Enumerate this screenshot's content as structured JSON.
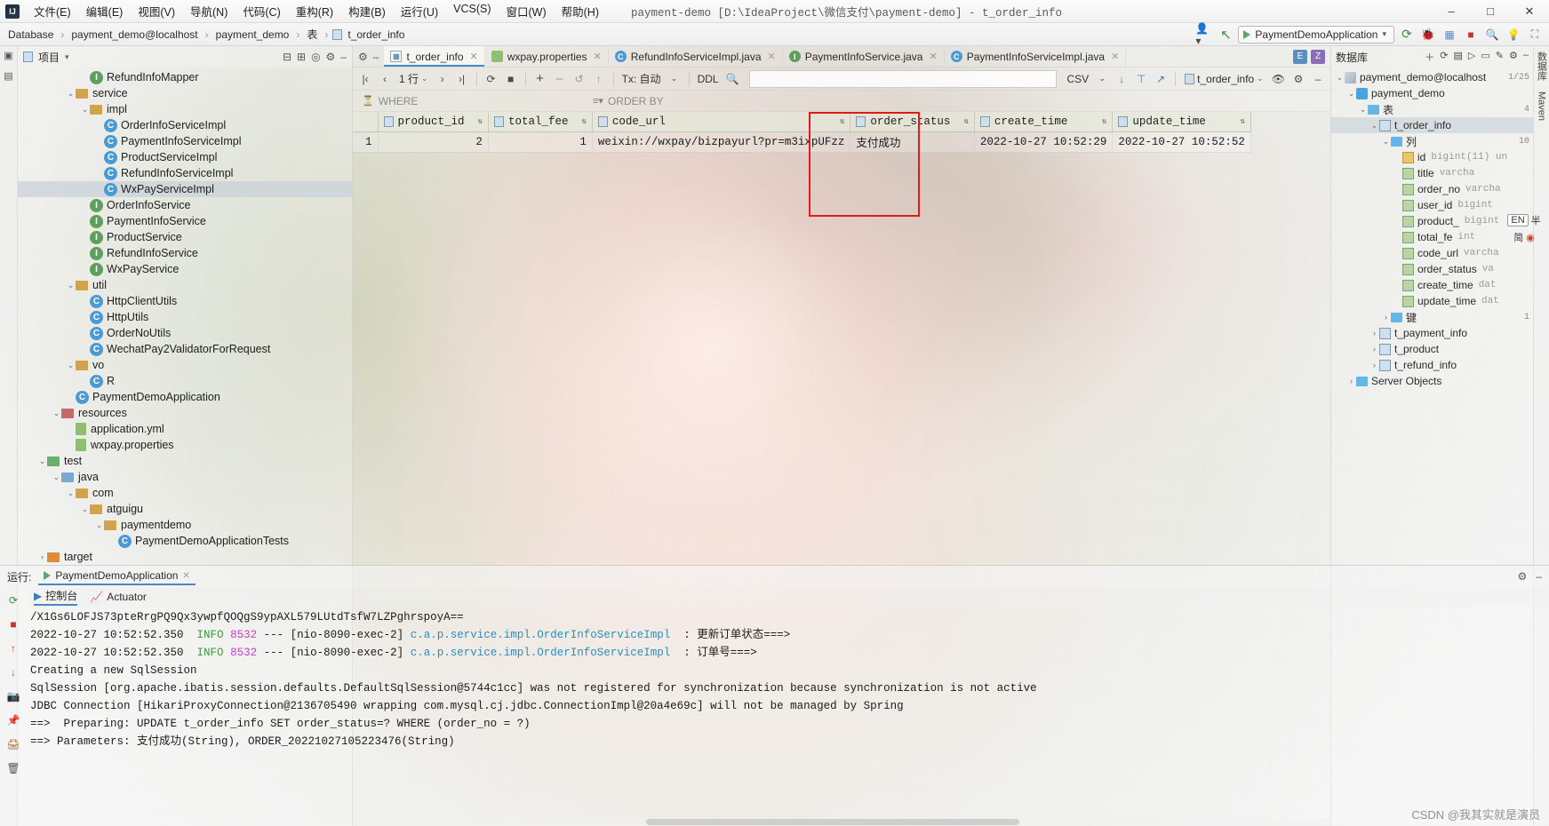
{
  "window": {
    "title": "payment-demo [D:\\IdeaProject\\微信支付\\payment-demo] - t_order_info",
    "logo": "IJ",
    "minimize": "–",
    "maximize": "□",
    "close": "✕"
  },
  "menu": [
    {
      "label": "文件(E)"
    },
    {
      "label": "编辑(E)"
    },
    {
      "label": "视图(V)"
    },
    {
      "label": "导航(N)"
    },
    {
      "label": "代码(C)"
    },
    {
      "label": "重构(R)"
    },
    {
      "label": "构建(B)"
    },
    {
      "label": "运行(U)"
    },
    {
      "label": "VCS(S)"
    },
    {
      "label": "窗口(W)"
    },
    {
      "label": "帮助(H)"
    }
  ],
  "breadcrumb": {
    "items": [
      "Database",
      "payment_demo@localhost",
      "payment_demo",
      "表",
      "t_order_info"
    ],
    "separator": "›",
    "table_icon": "table-icon"
  },
  "toolbar": {
    "run_config": "PaymentDemoApplication",
    "icons": [
      "user-icon",
      "back-arrow-icon",
      "run-icon",
      "rerun-icon",
      "debug-icon",
      "stop-icon",
      "search-icon",
      "bulb-icon",
      "scan-icon"
    ]
  },
  "left_strip": {
    "items": [
      "项目",
      "收藏"
    ]
  },
  "project_pane": {
    "title": "项目",
    "dropdown": "▾",
    "header_icons": [
      "collapse-icon",
      "expand-icon",
      "target-icon",
      "settings-icon",
      "hide-icon"
    ],
    "tree": [
      {
        "indent": 4,
        "arrow": "",
        "icon": "interface",
        "label": "RefundInfoMapper"
      },
      {
        "indent": 3,
        "arrow": "⌄",
        "icon": "folder",
        "label": "service"
      },
      {
        "indent": 4,
        "arrow": "⌄",
        "icon": "folder",
        "label": "impl"
      },
      {
        "indent": 5,
        "arrow": "",
        "icon": "class",
        "label": "OrderInfoServiceImpl"
      },
      {
        "indent": 5,
        "arrow": "",
        "icon": "class",
        "label": "PaymentInfoServiceImpl"
      },
      {
        "indent": 5,
        "arrow": "",
        "icon": "class",
        "label": "ProductServiceImpl"
      },
      {
        "indent": 5,
        "arrow": "",
        "icon": "class",
        "label": "RefundInfoServiceImpl"
      },
      {
        "indent": 5,
        "arrow": "",
        "icon": "class",
        "label": "WxPayServiceImpl",
        "selected": true
      },
      {
        "indent": 4,
        "arrow": "",
        "icon": "interface",
        "label": "OrderInfoService"
      },
      {
        "indent": 4,
        "arrow": "",
        "icon": "interface",
        "label": "PaymentInfoService"
      },
      {
        "indent": 4,
        "arrow": "",
        "icon": "interface",
        "label": "ProductService"
      },
      {
        "indent": 4,
        "arrow": "",
        "icon": "interface",
        "label": "RefundInfoService"
      },
      {
        "indent": 4,
        "arrow": "",
        "icon": "interface",
        "label": "WxPayService"
      },
      {
        "indent": 3,
        "arrow": "⌄",
        "icon": "folder",
        "label": "util"
      },
      {
        "indent": 4,
        "arrow": "",
        "icon": "class",
        "label": "HttpClientUtils"
      },
      {
        "indent": 4,
        "arrow": "",
        "icon": "class",
        "label": "HttpUtils"
      },
      {
        "indent": 4,
        "arrow": "",
        "icon": "class",
        "label": "OrderNoUtils"
      },
      {
        "indent": 4,
        "arrow": "",
        "icon": "class",
        "label": "WechatPay2ValidatorForRequest"
      },
      {
        "indent": 3,
        "arrow": "⌄",
        "icon": "folder",
        "label": "vo"
      },
      {
        "indent": 4,
        "arrow": "",
        "icon": "class",
        "label": "R"
      },
      {
        "indent": 3,
        "arrow": "",
        "icon": "class",
        "label": "PaymentDemoApplication"
      },
      {
        "indent": 2,
        "arrow": "⌄",
        "icon": "folder-res",
        "label": "resources"
      },
      {
        "indent": 3,
        "arrow": "",
        "icon": "file-yml",
        "label": "application.yml"
      },
      {
        "indent": 3,
        "arrow": "",
        "icon": "file-prop",
        "label": "wxpay.properties"
      },
      {
        "indent": 1,
        "arrow": "⌄",
        "icon": "folder-test",
        "label": "test"
      },
      {
        "indent": 2,
        "arrow": "⌄",
        "icon": "folder-src",
        "label": "java"
      },
      {
        "indent": 3,
        "arrow": "⌄",
        "icon": "folder",
        "label": "com"
      },
      {
        "indent": 4,
        "arrow": "⌄",
        "icon": "folder",
        "label": "atguigu"
      },
      {
        "indent": 5,
        "arrow": "⌄",
        "icon": "folder",
        "label": "paymentdemo"
      },
      {
        "indent": 6,
        "arrow": "",
        "icon": "class",
        "label": "PaymentDemoApplicationTests"
      },
      {
        "indent": 1,
        "arrow": "›",
        "icon": "folder-tgt",
        "label": "target"
      }
    ]
  },
  "editor": {
    "tabs": [
      {
        "label": "t_order_info",
        "icon": "table-icon",
        "active": true
      },
      {
        "label": "wxpay.properties",
        "icon": "properties-icon",
        "active": false
      },
      {
        "label": "RefundInfoServiceImpl.java",
        "icon": "class-icon",
        "active": false
      },
      {
        "label": "PaymentInfoService.java",
        "icon": "interface-icon",
        "active": false
      },
      {
        "label": "PaymentInfoServiceImpl.java",
        "icon": "class-icon",
        "active": false
      }
    ],
    "tail_chips": [
      "E",
      "Z"
    ]
  },
  "grid_toolbar": {
    "first_page": "|‹",
    "prev_page": "‹",
    "row_count": "1 行",
    "row_count_caret": "⌄",
    "next_page": "›",
    "last_page": "›|",
    "refresh": "⟳",
    "stop": "■",
    "add_row": "+",
    "remove_row": "–",
    "revert": "↺",
    "submit": "↑",
    "tx_label": "Tx: 自动",
    "tx_caret": "⌄",
    "ddl": "DDL",
    "search": "search-icon",
    "filter_value": "",
    "export_format": "CSV",
    "export_caret": "⌄",
    "download": "↓",
    "upload": "⊤",
    "open_editor": "↗",
    "table_name": "t_order_info",
    "table_caret": "⌄",
    "view_icon": "eye-icon",
    "settings_icon": "gear-icon",
    "minimize_icon": "–"
  },
  "filters": {
    "where_label": "WHERE",
    "where_icon": "filter-icon",
    "order_label": "ORDER BY",
    "order_icon": "sort-icon"
  },
  "table_data": {
    "columns": [
      "product_id",
      "total_fee",
      "code_url",
      "order_status",
      "create_time",
      "update_time"
    ],
    "row_numbers": [
      "1"
    ],
    "rows": [
      {
        "product_id": "2",
        "total_fee": "1",
        "code_url": "weixin://wxpay/bizpayurl?pr=m3ixpUFzz",
        "order_status": "支付成功",
        "create_time": "2022-10-27 10:52:29",
        "update_time": "2022-10-27 10:52:52"
      }
    ],
    "highlight_color": "#e01b1b"
  },
  "database_pane": {
    "title": "数据库",
    "toolbar_icons": [
      "add-icon",
      "refresh-icon",
      "table-icon",
      "run-icon",
      "console-icon",
      "filter-icon",
      "edit-icon",
      "settings-icon",
      "minimize-icon"
    ],
    "tree": [
      {
        "indent": 0,
        "arrow": "⌄",
        "icon": "server",
        "label": "payment_demo@localhost",
        "badge": "1/25"
      },
      {
        "indent": 1,
        "arrow": "⌄",
        "icon": "schema",
        "label": "payment_demo",
        "badge": ""
      },
      {
        "indent": 2,
        "arrow": "⌄",
        "icon": "folder",
        "label": "表",
        "badge": "4"
      },
      {
        "indent": 3,
        "arrow": "⌄",
        "icon": "table",
        "label": "t_order_info",
        "badge": "",
        "selected": true
      },
      {
        "indent": 4,
        "arrow": "⌄",
        "icon": "folder",
        "label": "列",
        "badge": "10"
      },
      {
        "indent": 5,
        "arrow": "",
        "icon": "key",
        "label": "id",
        "type": "bigint(11) un"
      },
      {
        "indent": 5,
        "arrow": "",
        "icon": "col",
        "label": "title",
        "type": "varcha"
      },
      {
        "indent": 5,
        "arrow": "",
        "icon": "col",
        "label": "order_no",
        "type": "varcha"
      },
      {
        "indent": 5,
        "arrow": "",
        "icon": "col",
        "label": "user_id",
        "type": "bigint"
      },
      {
        "indent": 5,
        "arrow": "",
        "icon": "col",
        "label": "product_",
        "type": "bigint"
      },
      {
        "indent": 5,
        "arrow": "",
        "icon": "col",
        "label": "total_fe",
        "type": "int"
      },
      {
        "indent": 5,
        "arrow": "",
        "icon": "col",
        "label": "code_url",
        "type": "varcha"
      },
      {
        "indent": 5,
        "arrow": "",
        "icon": "col",
        "label": "order_status",
        "type": "va"
      },
      {
        "indent": 5,
        "arrow": "",
        "icon": "col",
        "label": "create_time",
        "type": "dat"
      },
      {
        "indent": 5,
        "arrow": "",
        "icon": "col",
        "label": "update_time",
        "type": "dat"
      },
      {
        "indent": 4,
        "arrow": "›",
        "icon": "folder",
        "label": "键",
        "badge": "1"
      },
      {
        "indent": 3,
        "arrow": "›",
        "icon": "table",
        "label": "t_payment_info",
        "badge": ""
      },
      {
        "indent": 3,
        "arrow": "›",
        "icon": "table",
        "label": "t_product",
        "badge": ""
      },
      {
        "indent": 3,
        "arrow": "›",
        "icon": "table",
        "label": "t_refund_info",
        "badge": ""
      },
      {
        "indent": 1,
        "arrow": "›",
        "icon": "folder",
        "label": "Server Objects",
        "badge": ""
      }
    ]
  },
  "right_strip": {
    "items": [
      "数据库",
      "Maven"
    ]
  },
  "run_panel": {
    "label": "运行:",
    "tab_name": "PaymentDemoApplication",
    "tab_close": "✕",
    "header_icons": [
      "settings-icon",
      "minimize-icon"
    ],
    "gutter_icons": [
      "rerun-icon",
      "stop-icon",
      "up-icon",
      "down-icon",
      "camera-icon",
      "pin-icon",
      "trash-icon",
      "print-icon"
    ],
    "console_tabs": [
      {
        "label": "控制台",
        "icon": "console-icon",
        "active": true
      },
      {
        "label": "Actuator",
        "icon": "actuator-icon",
        "active": false
      }
    ],
    "log_lines": [
      {
        "type": "plain",
        "text": "/X1Gs6LOFJS73pteRrgPQ9Qx3ywpfQOQgS9ypAXL579LUtdTsfW7LZPghrspoyA=="
      },
      {
        "type": "log",
        "ts": "2022-10-27 10:52:52.350",
        "level": "INFO",
        "pid": "8532",
        "dash": "---",
        "thread": "[nio-8090-exec-2]",
        "cls": "c.a.p.service.impl.OrderInfoServiceImpl",
        "colon": ":",
        "msg": "更新订单状态===>"
      },
      {
        "type": "log",
        "ts": "2022-10-27 10:52:52.350",
        "level": "INFO",
        "pid": "8532",
        "dash": "---",
        "thread": "[nio-8090-exec-2]",
        "cls": "c.a.p.service.impl.OrderInfoServiceImpl",
        "colon": ":",
        "msg": "订单号===>"
      },
      {
        "type": "plain",
        "text": "Creating a new SqlSession"
      },
      {
        "type": "plain",
        "text": "SqlSession [org.apache.ibatis.session.defaults.DefaultSqlSession@5744c1cc] was not registered for synchronization because synchronization is not active"
      },
      {
        "type": "plain",
        "text": "JDBC Connection [HikariProxyConnection@2136705490 wrapping com.mysql.cj.jdbc.ConnectionImpl@20a4e69c] will not be managed by Spring"
      },
      {
        "type": "plain",
        "text": "==>  Preparing: UPDATE t_order_info SET order_status=? WHERE (order_no = ?)"
      },
      {
        "type": "plain",
        "text": "==> Parameters: 支付成功(String), ORDER_20221027105223476(String)"
      }
    ]
  },
  "overlay": {
    "ime_en": "EN",
    "ime_mode": "半",
    "ime_simp": "简",
    "watermark": "CSDN @我其实就是演员"
  }
}
